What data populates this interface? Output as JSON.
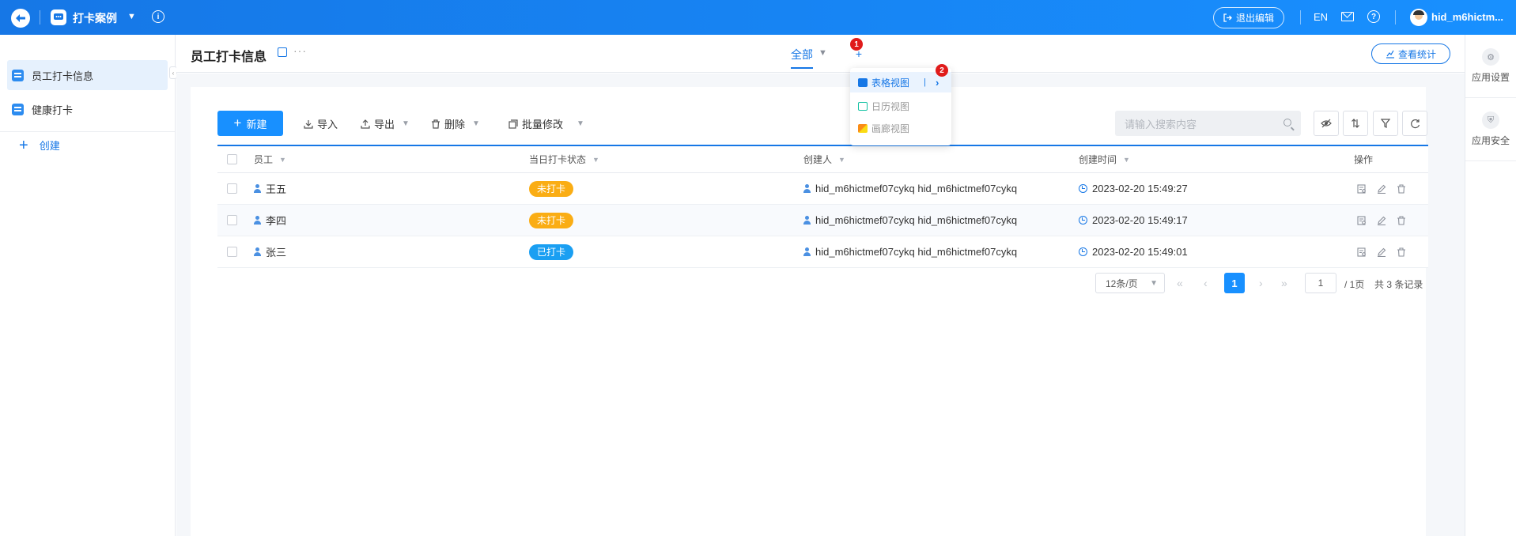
{
  "topbar": {
    "app_title": "打卡案例",
    "exit_edit_label": "退出编辑",
    "lang_label": "EN",
    "user_name": "hid_m6hictm..."
  },
  "sidebar": {
    "items": [
      {
        "label": "员工打卡信息",
        "active": true
      },
      {
        "label": "健康打卡",
        "active": false
      }
    ],
    "create_label": "创建"
  },
  "rightbar": {
    "items": [
      {
        "label": "应用设置",
        "icon": "gear-icon"
      },
      {
        "label": "应用安全",
        "icon": "shield-icon"
      }
    ]
  },
  "header": {
    "page_title": "员工打卡信息",
    "view_tab_label": "全部",
    "stats_button_label": "查看统计"
  },
  "view_dropdown": {
    "items": [
      {
        "label": "表格视图",
        "icon": "table-icon",
        "active": true
      },
      {
        "label": "日历视图",
        "icon": "calendar-icon",
        "active": false
      },
      {
        "label": "画廊视图",
        "icon": "gallery-icon",
        "active": false
      }
    ],
    "step_badges": [
      "1",
      "2"
    ]
  },
  "toolbar": {
    "new_label": "新建",
    "import_label": "导入",
    "export_label": "导出",
    "delete_label": "删除",
    "batch_edit_label": "批量修改",
    "search_placeholder": "请输入搜索内容"
  },
  "table": {
    "columns": [
      "员工",
      "当日打卡状态",
      "创建人",
      "创建时间",
      "操作"
    ],
    "rows": [
      {
        "employee": "王五",
        "status": "未打卡",
        "status_color": "#faad14",
        "creator": "hid_m6hictmef07cykq hid_m6hictmef07cykq",
        "created_at": "2023-02-20 15:49:27"
      },
      {
        "employee": "李四",
        "status": "未打卡",
        "status_color": "#faad14",
        "creator": "hid_m6hictmef07cykq hid_m6hictmef07cykq",
        "created_at": "2023-02-20 15:49:17"
      },
      {
        "employee": "张三",
        "status": "已打卡",
        "status_color": "#1a9ff2",
        "creator": "hid_m6hictmef07cykq hid_m6hictmef07cykq",
        "created_at": "2023-02-20 15:49:01"
      }
    ]
  },
  "pagination": {
    "page_size_label": "12条/页",
    "current_page": "1",
    "page_input": "1",
    "total_pages_label": "/ 1页",
    "total_records_label": "共 3 条记录"
  },
  "colors": {
    "primary": "#1677e6",
    "not_checked_in": "#faad14",
    "checked_in": "#1a9ff2"
  }
}
